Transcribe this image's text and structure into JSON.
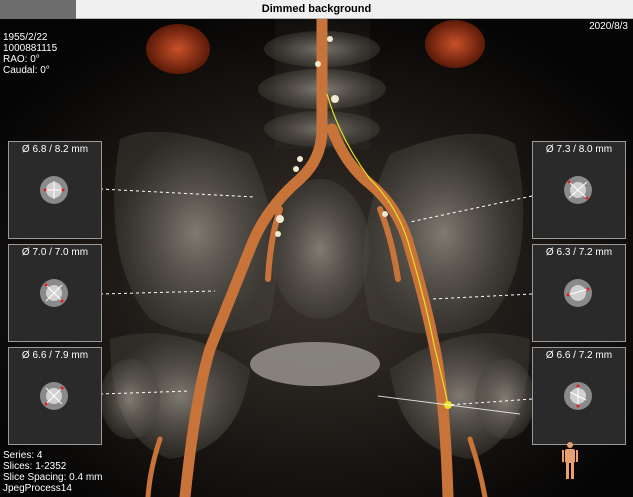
{
  "window": {
    "title": "Dimmed background"
  },
  "overlay": {
    "top_left": [
      "1955/2/22",
      "1000881115",
      "RAO: 0°",
      "Caudal: 0°"
    ],
    "top_right": "2020/8/3",
    "bottom_left": [
      "Series: 4",
      "Slices: 1-2352",
      "Slice Spacing: 0.4 mm",
      "JpegProcess14"
    ]
  },
  "thumbnails": {
    "left": [
      {
        "label": "Ø 6.8 / 8.2 mm"
      },
      {
        "label": "Ø 7.0 / 7.0 mm"
      },
      {
        "label": "Ø 6.6 / 7.9 mm"
      }
    ],
    "right": [
      {
        "label": "Ø 7.3 / 8.0 mm"
      },
      {
        "label": "Ø 6.3 / 7.2 mm"
      },
      {
        "label": "Ø 6.6 / 7.2 mm"
      }
    ]
  },
  "colors": {
    "vessel": "#c8733a",
    "centerline": "#e8e020",
    "marker": "#e02020"
  }
}
